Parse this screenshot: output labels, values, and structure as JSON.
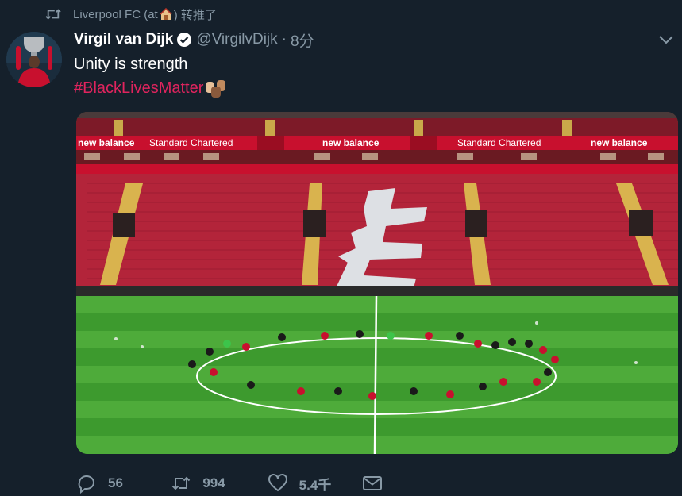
{
  "retweet": {
    "account": "Liverpool FC (at",
    "suffix": ") 转推了"
  },
  "tweet": {
    "author_name": "Virgil van Dijk",
    "handle": "@VirgilvDijk",
    "separator": "·",
    "time": "8分",
    "text": "Unity is strength",
    "hashtag": "#BlackLivesMatter"
  },
  "media": {
    "banners": [
      "new balance",
      "Standard Chartered",
      "new balance",
      "Standard Chartered",
      "new balance"
    ]
  },
  "actions": {
    "replies": "56",
    "retweets": "994",
    "likes": "5.4千"
  },
  "colors": {
    "background": "#15202b",
    "muted_text": "#8899a6",
    "hashtag": "#e0245e",
    "verified": "#ffffff",
    "pitch": "#3d9a2e",
    "stand": "#b3243a"
  },
  "icons": [
    "retweet-icon",
    "house-icon",
    "verified-badge-icon",
    "chevron-down-icon",
    "fist-icon",
    "reply-icon",
    "heart-icon",
    "mail-icon"
  ]
}
